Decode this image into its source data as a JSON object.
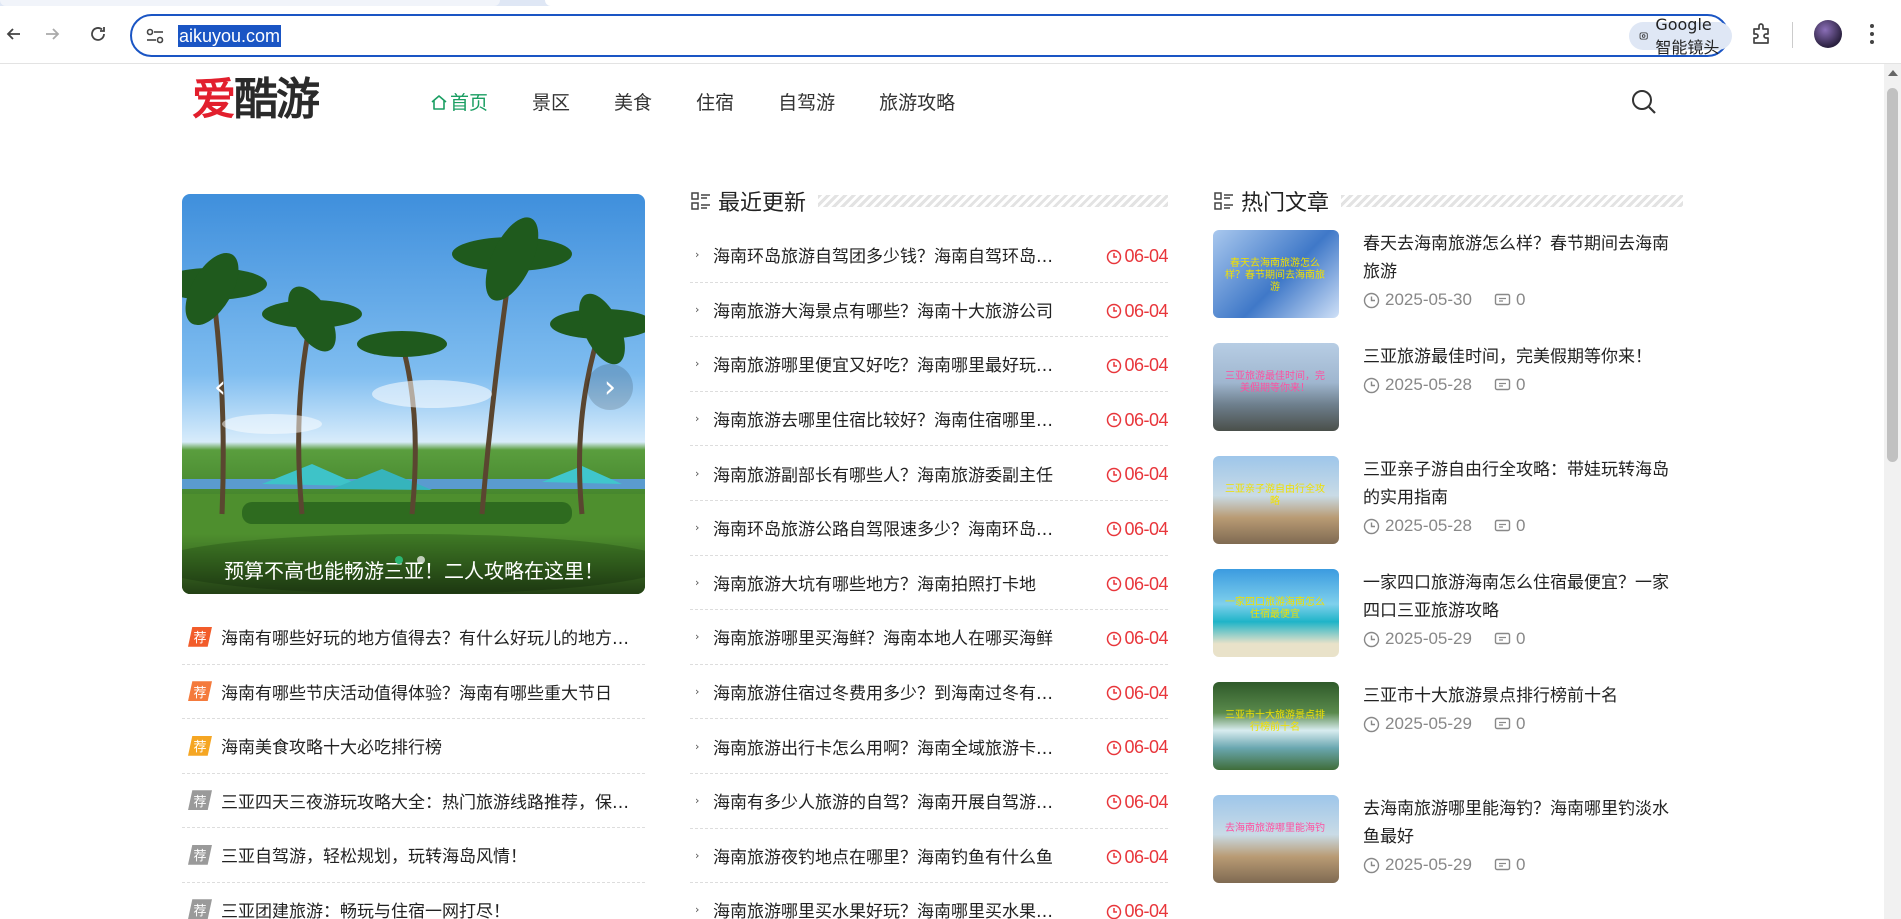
{
  "browser": {
    "url": "aikuyou.com",
    "lens_label": "Google 智能镜头"
  },
  "site": {
    "logo_part1": "爱",
    "logo_part2": "酷游",
    "nav": [
      {
        "label": "首页",
        "active": true
      },
      {
        "label": "景区",
        "active": false
      },
      {
        "label": "美食",
        "active": false
      },
      {
        "label": "住宿",
        "active": false
      },
      {
        "label": "自驾游",
        "active": false
      },
      {
        "label": "旅游攻略",
        "active": false
      }
    ]
  },
  "slider": {
    "caption": "预算不高也能畅游三亚！二人攻略在这里！"
  },
  "recommended": [
    {
      "tag": "荐",
      "color": "#f25c2a",
      "title": "海南有哪些好玩的地方值得去？有什么好玩儿的地方推荐？"
    },
    {
      "tag": "荐",
      "color": "#f47a3c",
      "title": "海南有哪些节庆活动值得体验？海南有哪些重大节日"
    },
    {
      "tag": "荐",
      "color": "#f5a623",
      "title": "海南美食攻略十大必吃排行榜"
    },
    {
      "tag": "荐",
      "color": "#9a9a9a",
      "title": "三亚四天三夜游玩攻略大全：热门旅游线路推荐，保姆级攻略"
    },
    {
      "tag": "荐",
      "color": "#9a9a9a",
      "title": "三亚自驾游，轻松规划，玩转海岛风情！"
    },
    {
      "tag": "荐",
      "color": "#9a9a9a",
      "title": "三亚团建旅游：畅玩与住宿一网打尽！"
    }
  ],
  "latest": {
    "heading": "最近更新",
    "items": [
      {
        "title": "海南环岛旅游自驾团多少钱？海南自驾环岛攻略",
        "date": "06-04"
      },
      {
        "title": "海南旅游大海景点有哪些？海南十大旅游公司",
        "date": "06-04"
      },
      {
        "title": "海南旅游哪里便宜又好吃？海南哪里最好玩又便宜",
        "date": "06-04"
      },
      {
        "title": "海南旅游去哪里住宿比较好？海南住宿哪里性价比高",
        "date": "06-04"
      },
      {
        "title": "海南旅游副部长有哪些人？海南旅游委副主任",
        "date": "06-04"
      },
      {
        "title": "海南环岛旅游公路自驾限速多少？海南环岛公路限速",
        "date": "06-04"
      },
      {
        "title": "海南旅游大坑有哪些地方？海南拍照打卡地",
        "date": "06-04"
      },
      {
        "title": "海南旅游哪里买海鲜？海南本地人在哪买海鲜",
        "date": "06-04"
      },
      {
        "title": "海南旅游住宿过冬费用多少？到海南过冬有什么要求",
        "date": "06-04"
      },
      {
        "title": "海南旅游出行卡怎么用啊？海南全域旅游卡怎么用",
        "date": "06-04"
      },
      {
        "title": "海南有多少人旅游的自驾？海南开展自驾游的人数",
        "date": "06-04"
      },
      {
        "title": "海南旅游夜钓地点在哪里？海南钓鱼有什么鱼",
        "date": "06-04"
      },
      {
        "title": "海南旅游哪里买水果好玩？海南哪里买水果便宜",
        "date": "06-04"
      }
    ]
  },
  "hot": {
    "heading": "热门文章",
    "items": [
      {
        "title": "春天去海南旅游怎么样？春节期间去海南旅游",
        "date": "2025-05-30",
        "comments": "0",
        "thumb_text": "春天去海南旅游怎么样？春节期间去海南旅游"
      },
      {
        "title": "三亚旅游最佳时间，完美假期等你来！",
        "date": "2025-05-28",
        "comments": "0",
        "thumb_text": "三亚旅游最佳时间，完美假期等你来！"
      },
      {
        "title": "三亚亲子游自由行全攻略：带娃玩转海岛的实用指南",
        "date": "2025-05-28",
        "comments": "0",
        "thumb_text": "三亚亲子游自由行全攻略"
      },
      {
        "title": "一家四口旅游海南怎么住宿最便宜？一家四口三亚旅游攻略",
        "date": "2025-05-29",
        "comments": "0",
        "thumb_text": "一家四口旅游海南怎么住宿最便宜"
      },
      {
        "title": "三亚市十大旅游景点排行榜前十名",
        "date": "2025-05-29",
        "comments": "0",
        "thumb_text": "三亚市十大旅游景点排行榜前十名"
      },
      {
        "title": "去海南旅游哪里能海钓？海南哪里钓淡水鱼最好",
        "date": "2025-05-29",
        "comments": "0",
        "thumb_text": "去海南旅游哪里能海钓"
      }
    ]
  }
}
